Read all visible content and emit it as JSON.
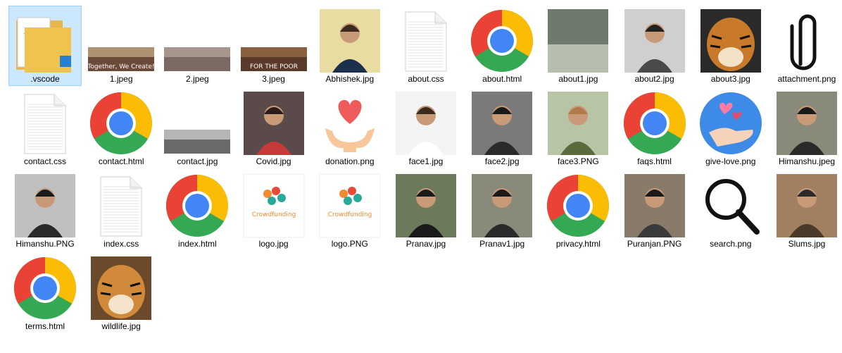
{
  "files": [
    {
      "name": ".vscode",
      "kind": "folder",
      "selected": true
    },
    {
      "name": "1.jpeg",
      "kind": "banner",
      "text": "Together, We Create!",
      "colors": [
        "#6b4a3a",
        "#c9b08a"
      ]
    },
    {
      "name": "2.jpeg",
      "kind": "banner",
      "colors": [
        "#7a6a62",
        "#b9a99c"
      ]
    },
    {
      "name": "3.jpeg",
      "kind": "banner",
      "text": "FOR THE POOR",
      "colors": [
        "#5a3a2a",
        "#a0704a"
      ]
    },
    {
      "name": "Abhishek.jpg",
      "kind": "person",
      "colors": [
        "#e8dca0",
        "#1c2f4d",
        "#3b2b20"
      ]
    },
    {
      "name": "about.css",
      "kind": "doc"
    },
    {
      "name": "about.html",
      "kind": "chrome"
    },
    {
      "name": "about1.jpg",
      "kind": "photo",
      "colors": [
        "#6e7a6c",
        "#b6bfae"
      ]
    },
    {
      "name": "about2.jpg",
      "kind": "person",
      "colors": [
        "#cfcfcf",
        "#4a4a4a",
        "#222222"
      ]
    },
    {
      "name": "about3.jpg",
      "kind": "tiger",
      "colors": [
        "#2a2a2a",
        "#c87a2a",
        "#f2e2c8"
      ]
    },
    {
      "name": "attachment.png",
      "kind": "clip"
    },
    {
      "name": "contact.css",
      "kind": "doc"
    },
    {
      "name": "contact.html",
      "kind": "chrome"
    },
    {
      "name": "contact.jpg",
      "kind": "banner",
      "colors": [
        "#6a6a6a",
        "#d7d7d7"
      ]
    },
    {
      "name": "Covid.jpg",
      "kind": "person",
      "colors": [
        "#5a4a4a",
        "#c83a3a",
        "#2a1a1a"
      ]
    },
    {
      "name": "donation.png",
      "kind": "heart"
    },
    {
      "name": "face1.jpg",
      "kind": "person",
      "colors": [
        "#f4f4f4",
        "#ffffff",
        "#3b2a20"
      ]
    },
    {
      "name": "face2.jpg",
      "kind": "person",
      "colors": [
        "#7a7a7a",
        "#2a2a2a",
        "#1a1a1a"
      ]
    },
    {
      "name": "face3.PNG",
      "kind": "person",
      "colors": [
        "#b8c4a6",
        "#5a6a3a",
        "#b07a4a"
      ]
    },
    {
      "name": "faqs.html",
      "kind": "chrome"
    },
    {
      "name": "give-love.png",
      "kind": "give"
    },
    {
      "name": "Himanshu.jpeg",
      "kind": "person",
      "colors": [
        "#8a8a7a",
        "#2a2a2a",
        "#1a1a1a"
      ]
    },
    {
      "name": "Himanshu.PNG",
      "kind": "person",
      "colors": [
        "#c0c0c0",
        "#2a2a2a",
        "#1a1a1a"
      ]
    },
    {
      "name": "index.css",
      "kind": "doc"
    },
    {
      "name": "index.html",
      "kind": "chrome"
    },
    {
      "name": "logo.jpg",
      "kind": "logo",
      "text": "Crowdfunding"
    },
    {
      "name": "logo.PNG",
      "kind": "logo",
      "text": "Crowdfunding"
    },
    {
      "name": "Pranav.jpg",
      "kind": "person",
      "colors": [
        "#6a7a5a",
        "#1a1a1a",
        "#1a1a1a"
      ]
    },
    {
      "name": "Pranav1.jpg",
      "kind": "person",
      "colors": [
        "#8a8a7a",
        "#2a2a2a",
        "#1a1a1a"
      ]
    },
    {
      "name": "privacy.html",
      "kind": "chrome"
    },
    {
      "name": "Puranjan.PNG",
      "kind": "person",
      "colors": [
        "#8a7a6a",
        "#3a3a3a",
        "#1a1a1a"
      ]
    },
    {
      "name": "search.png",
      "kind": "search"
    },
    {
      "name": "Slums.jpg",
      "kind": "person",
      "colors": [
        "#a08060",
        "#4a3a2a",
        "#2a2a2a"
      ]
    },
    {
      "name": "terms.html",
      "kind": "chrome"
    },
    {
      "name": "wildlife.jpg",
      "kind": "tiger",
      "colors": [
        "#6a4a2a",
        "#d08a3a",
        "#f4e4cc"
      ]
    }
  ],
  "layout_cols": 11
}
